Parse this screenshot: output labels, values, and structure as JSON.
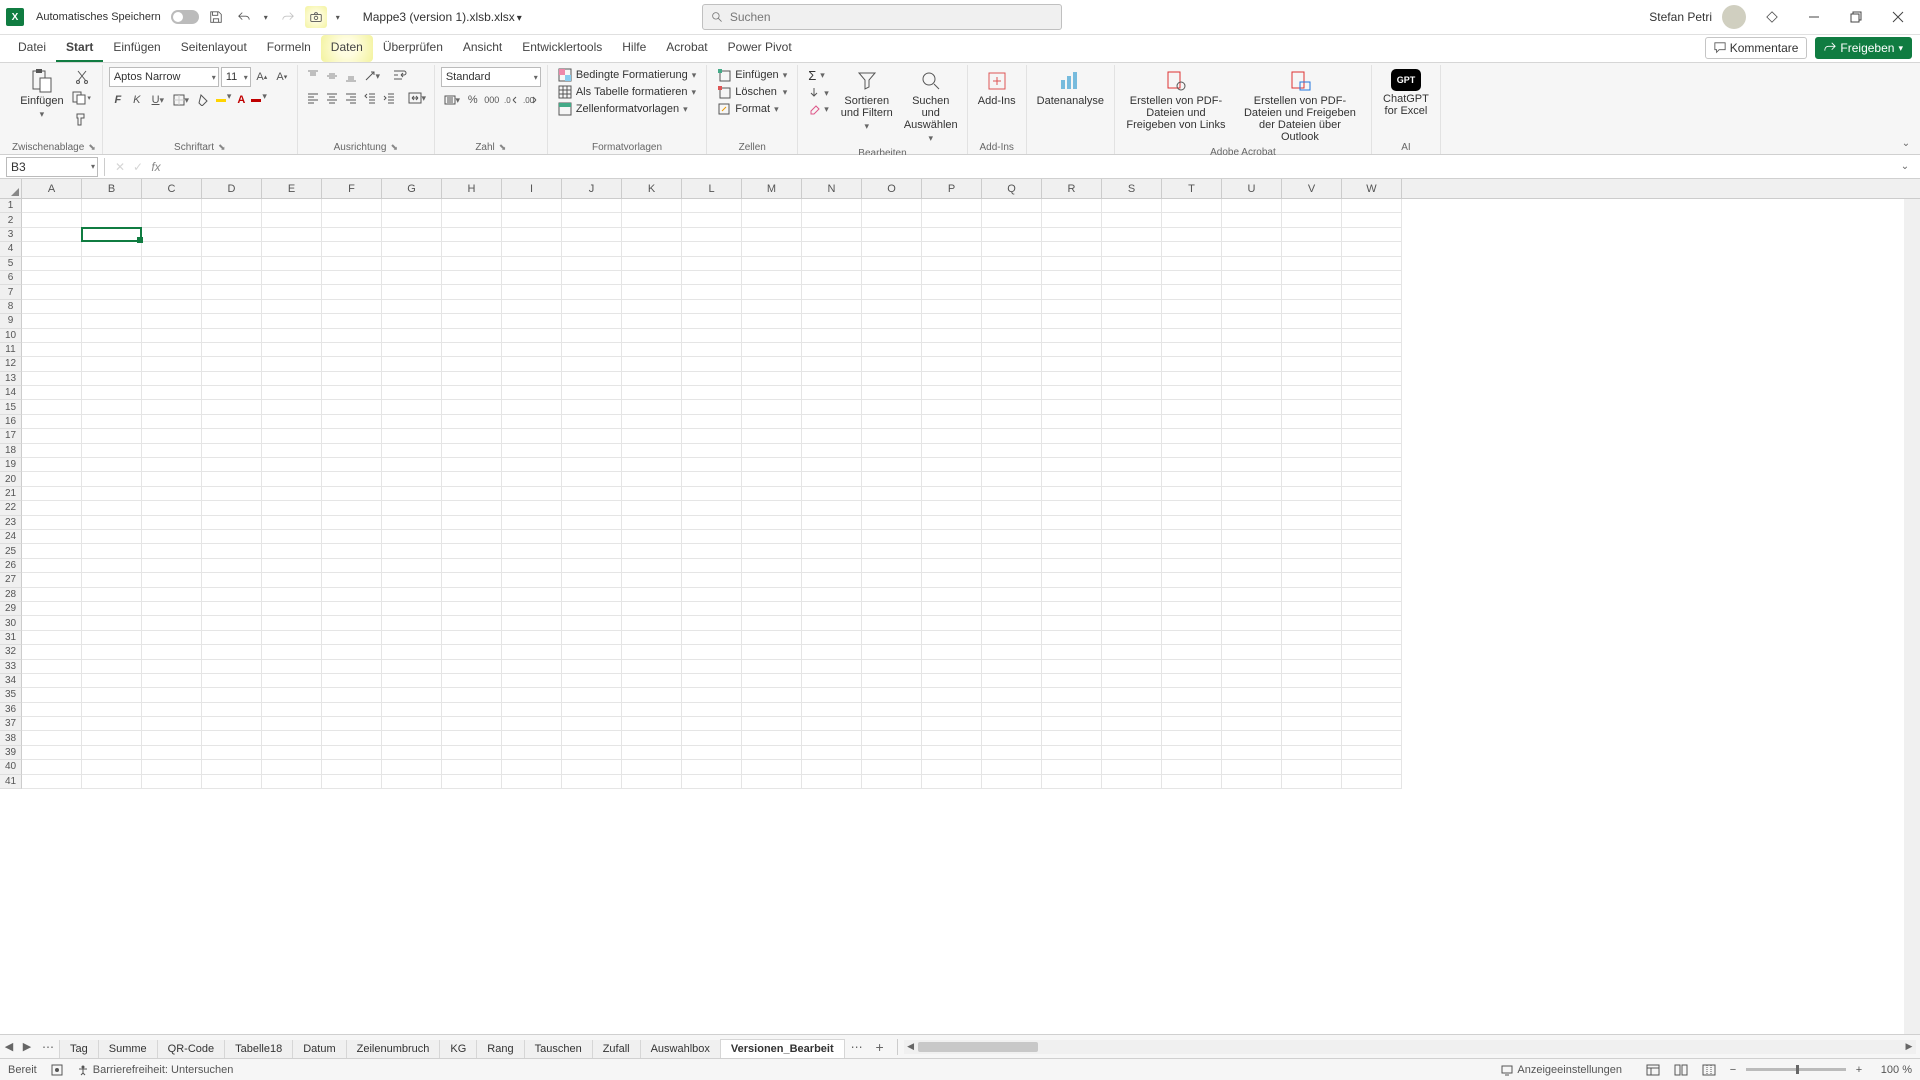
{
  "titlebar": {
    "autosave_label": "Automatisches Speichern",
    "filename": "Mappe3 (version 1).xlsb.xlsx",
    "search_placeholder": "Suchen",
    "user_name": "Stefan Petri"
  },
  "menu": {
    "tabs": [
      "Datei",
      "Start",
      "Einfügen",
      "Seitenlayout",
      "Formeln",
      "Daten",
      "Überprüfen",
      "Ansicht",
      "Entwicklertools",
      "Hilfe",
      "Acrobat",
      "Power Pivot"
    ],
    "active_index": 1,
    "kommentare": "Kommentare",
    "freigeben": "Freigeben"
  },
  "ribbon": {
    "clipboard": {
      "paste": "Einfügen",
      "label": "Zwischenablage"
    },
    "font": {
      "name": "Aptos Narrow",
      "size": "11",
      "label": "Schriftart"
    },
    "align": {
      "label": "Ausrichtung"
    },
    "number": {
      "format": "Standard",
      "label": "Zahl"
    },
    "styles": {
      "cond": "Bedingte Formatierung",
      "table": "Als Tabelle formatieren",
      "cell": "Zellenformatvorlagen",
      "label": "Formatvorlagen"
    },
    "cells": {
      "insert": "Einfügen",
      "delete": "Löschen",
      "format": "Format",
      "label": "Zellen"
    },
    "editing": {
      "sortfilter": "Sortieren und Filtern",
      "findselect": "Suchen und Auswählen",
      "label": "Bearbeiten"
    },
    "addins": {
      "btn": "Add-Ins",
      "label": "Add-Ins"
    },
    "data": {
      "btn": "Datenanalyse"
    },
    "acrobat": {
      "btn1": "Erstellen von PDF-Dateien und Freigeben von Links",
      "btn2": "Erstellen von PDF-Dateien und Freigeben der Dateien über Outlook",
      "label": "Adobe Acrobat"
    },
    "ai": {
      "btn": "ChatGPT for Excel",
      "label": "AI"
    }
  },
  "formula_bar": {
    "cell_ref": "B3",
    "formula": ""
  },
  "columns": [
    "A",
    "B",
    "C",
    "D",
    "E",
    "F",
    "G",
    "H",
    "I",
    "J",
    "K",
    "L",
    "M",
    "N",
    "O",
    "P",
    "Q",
    "R",
    "S",
    "T",
    "U",
    "V",
    "W"
  ],
  "row_count": 41,
  "selection": {
    "cell": "B3",
    "col_index": 1,
    "row_index": 2
  },
  "sheets": {
    "tabs": [
      "Tag",
      "Summe",
      "QR-Code",
      "Tabelle18",
      "Datum",
      "Zeilenumbruch",
      "KG",
      "Rang",
      "Tauschen",
      "Zufall",
      "Auswahlbox",
      "Versionen_Bearbeit"
    ],
    "active_index": 11
  },
  "statusbar": {
    "ready": "Bereit",
    "accessibility": "Barrierefreiheit: Untersuchen",
    "display_settings": "Anzeigeeinstellungen",
    "zoom": "100 %"
  }
}
